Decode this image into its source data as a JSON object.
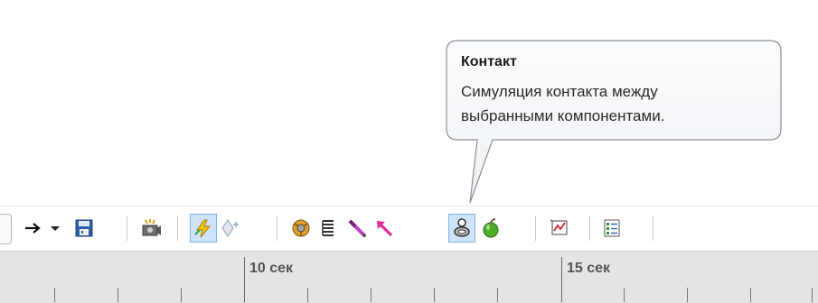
{
  "tooltip": {
    "title": "Контакт",
    "line1": "Симуляция контакта между",
    "line2": "выбранными компонентами."
  },
  "toolbar": {
    "items": [
      {
        "name": "arrow-right-icon",
        "active": false
      },
      {
        "name": "dropdown-chevron-icon",
        "active": false
      },
      {
        "name": "save-animation-icon",
        "active": false
      },
      {
        "name": "camera-icon",
        "active": false
      },
      {
        "name": "calculate-icon",
        "active": true
      },
      {
        "name": "key-point-icon",
        "active": false
      },
      {
        "name": "motor-icon",
        "active": false
      },
      {
        "name": "spring-icon",
        "active": false
      },
      {
        "name": "damper-icon",
        "active": false
      },
      {
        "name": "force-icon",
        "active": false
      },
      {
        "name": "contact-icon",
        "active": true
      },
      {
        "name": "gravity-icon",
        "active": false
      },
      {
        "name": "results-plot-icon",
        "active": false
      },
      {
        "name": "properties-icon",
        "active": false
      }
    ]
  },
  "timeline": {
    "label_10": "10 сек",
    "label_15": "15 сек"
  },
  "colors": {
    "active_bg": "#cfe4fb",
    "ruler_bg": "#e4e4e4",
    "tooltip_bg": "#f7f9fb"
  }
}
